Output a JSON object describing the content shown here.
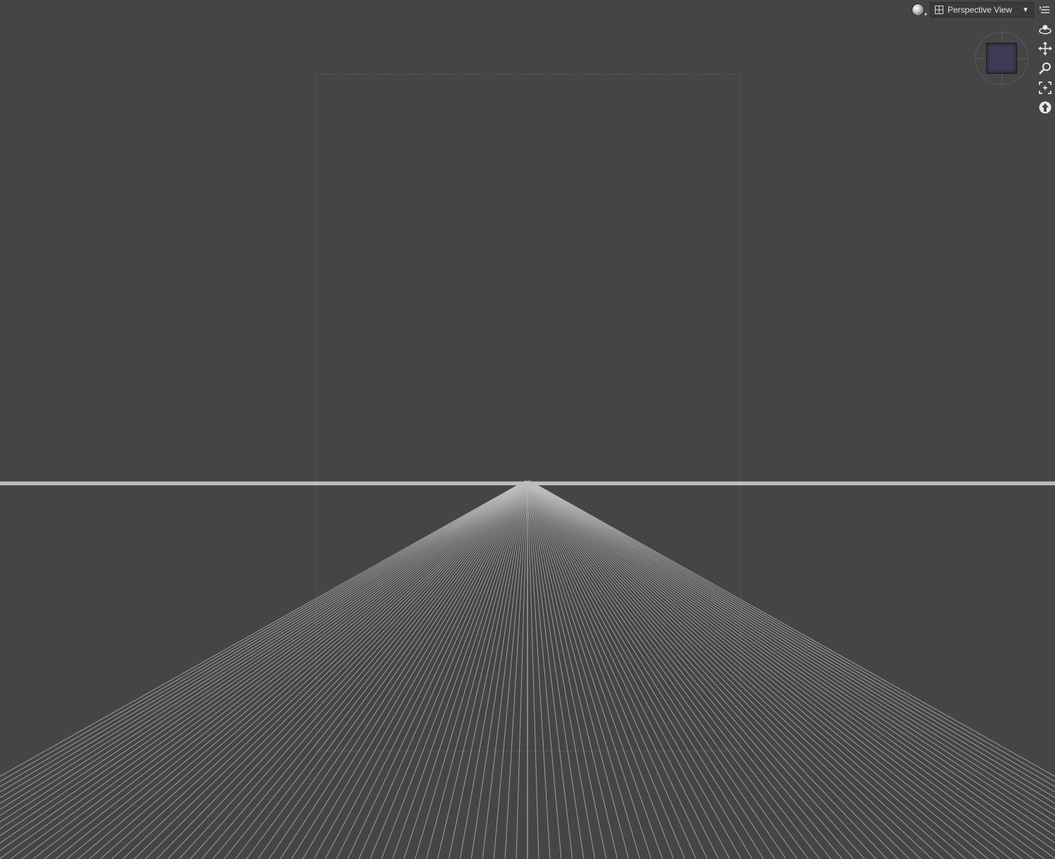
{
  "viewport": {
    "background": "#454545",
    "grid_color": "#bdbdbd"
  },
  "toolbar": {
    "shading_icon": "shading-sphere-icon",
    "view_icon": "view-layout-icon",
    "view_label": "Perspective View",
    "view_caret": "▼",
    "menu_icon": "viewport-menu-icon"
  },
  "nav_cube": {
    "icon": "navigation-cube-icon",
    "face_color": "#3e3c55"
  },
  "camera_tools": [
    {
      "name": "orbit-camera-icon"
    },
    {
      "name": "pan-camera-icon"
    },
    {
      "name": "zoom-camera-icon"
    },
    {
      "name": "frame-selection-icon"
    },
    {
      "name": "aim-camera-icon"
    }
  ]
}
